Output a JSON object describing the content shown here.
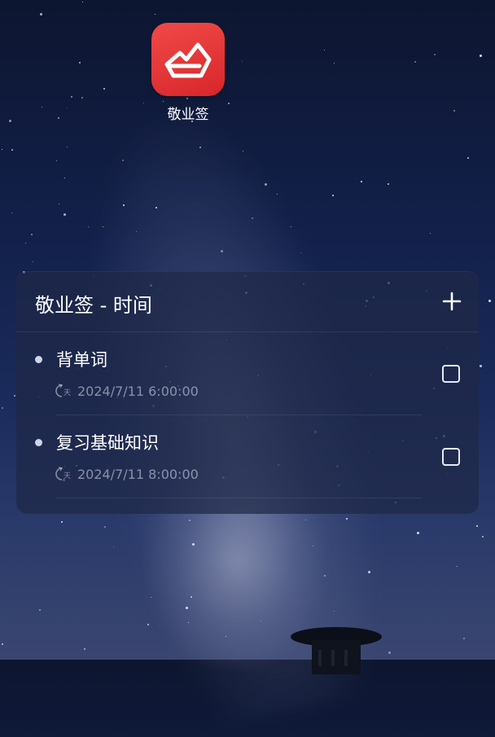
{
  "home": {
    "app_label": "敬业签",
    "app_icon": "jingyeqian-app-icon"
  },
  "widget": {
    "title": "敬业签 - 时间",
    "add_icon": "plus-icon",
    "tasks": [
      {
        "title": "背单词",
        "time": "2024/7/11 6:00:00",
        "repeat_icon": "repeat-day-icon",
        "checked": false
      },
      {
        "title": "复习基础知识",
        "time": "2024/7/11 8:00:00",
        "repeat_icon": "repeat-day-icon",
        "checked": false
      }
    ]
  },
  "colors": {
    "app_icon_red": "#e5363a",
    "widget_bg": "rgba(30,40,70,0.72)",
    "text_primary": "#ffffff",
    "text_secondary": "#dce2f0"
  }
}
